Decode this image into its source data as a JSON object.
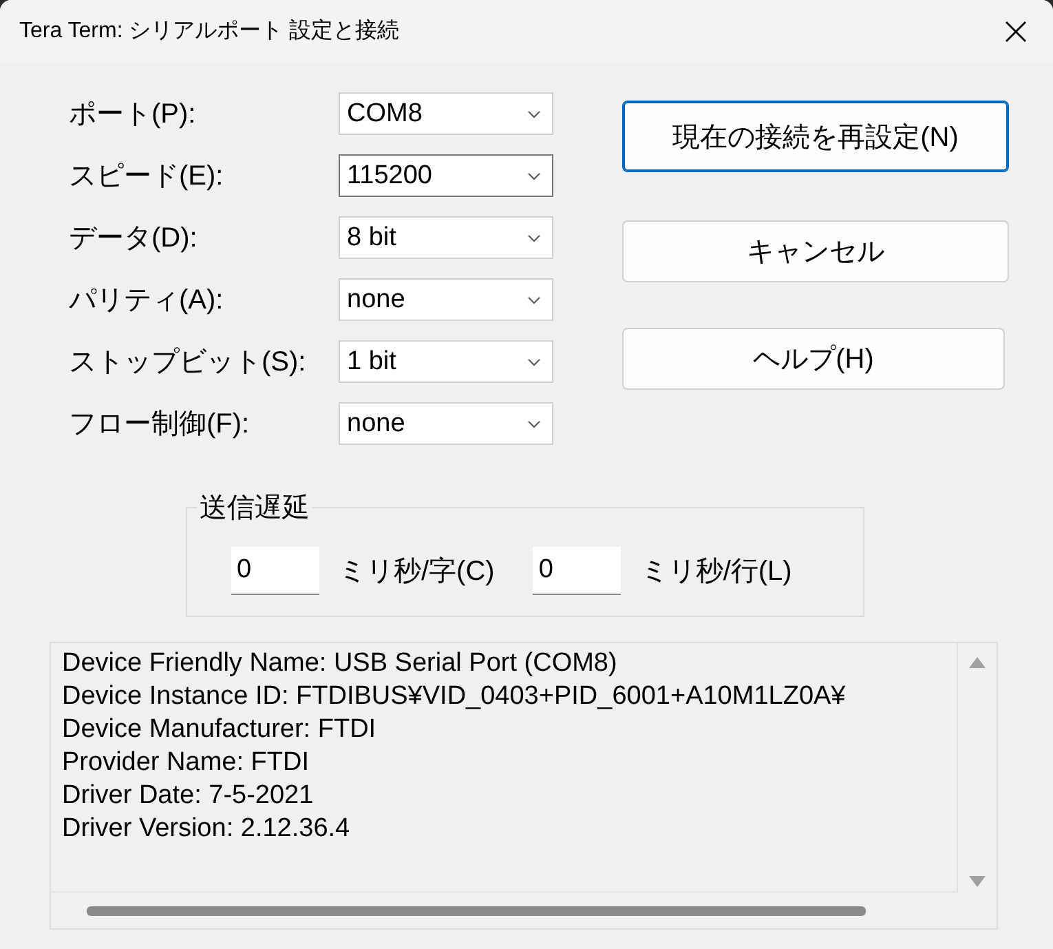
{
  "window": {
    "title": "Tera Term: シリアルポート 設定と接続"
  },
  "settings": [
    {
      "label": "ポート(P):",
      "value": "COM8",
      "focused": false
    },
    {
      "label": "スピード(E):",
      "value": "115200",
      "focused": true
    },
    {
      "label": "データ(D):",
      "value": "8 bit",
      "focused": false
    },
    {
      "label": "パリティ(A):",
      "value": "none",
      "focused": false
    },
    {
      "label": "ストップビット(S):",
      "value": "1 bit",
      "focused": false
    },
    {
      "label": "フロー制御(F):",
      "value": "none",
      "focused": false
    }
  ],
  "buttons": [
    {
      "label": "現在の接続を再設定(N)",
      "default": true
    },
    {
      "label": "キャンセル",
      "default": false
    },
    {
      "label": "ヘルプ(H)",
      "default": false
    }
  ],
  "delay": {
    "title": "送信遅延",
    "fields": [
      {
        "value": "0",
        "unit": "ミリ秒/字(C)"
      },
      {
        "value": "0",
        "unit": "ミリ秒/行(L)"
      }
    ]
  },
  "device_info": {
    "lines": [
      "Device Friendly Name: USB Serial Port (COM8)",
      "Device Instance ID: FTDIBUS¥VID_0403+PID_6001+A10M1LZ0A¥",
      "Device Manufacturer: FTDI",
      "Provider Name: FTDI",
      "Driver Date: 7-5-2021",
      "Driver Version: 2.12.36.4"
    ]
  }
}
